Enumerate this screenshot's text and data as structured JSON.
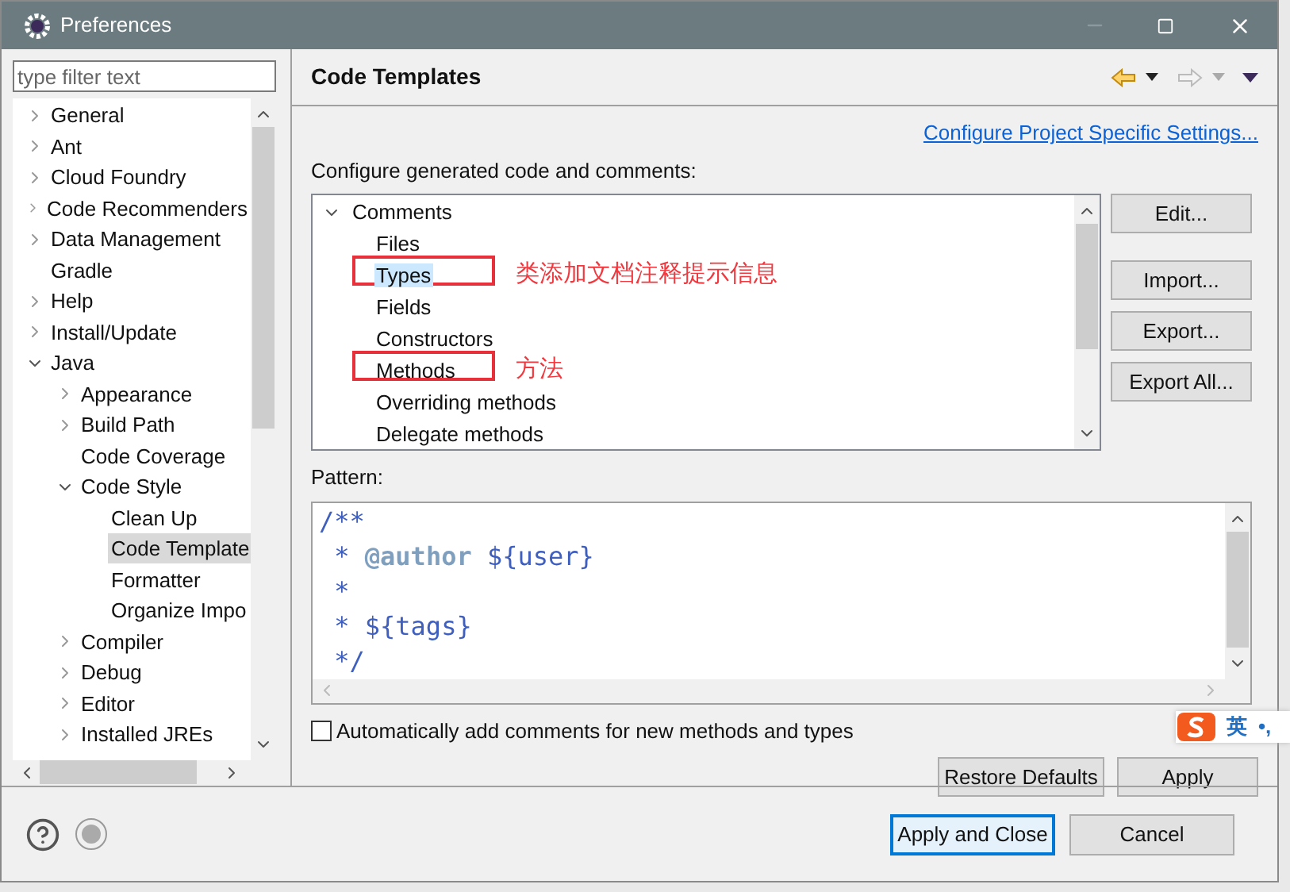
{
  "window": {
    "title": "Preferences"
  },
  "filter": {
    "placeholder": "type filter text"
  },
  "nav": [
    {
      "label": "General",
      "expanded": false,
      "selected": false
    },
    {
      "label": "Ant",
      "expanded": false,
      "selected": false
    },
    {
      "label": "Cloud Foundry",
      "expanded": false,
      "selected": false
    },
    {
      "label": "Code Recommenders",
      "expanded": false,
      "selected": false
    },
    {
      "label": "Data Management",
      "expanded": false,
      "selected": false
    },
    {
      "label": "Gradle",
      "selected": false
    },
    {
      "label": "Help",
      "expanded": false,
      "selected": false
    },
    {
      "label": "Install/Update",
      "expanded": false,
      "selected": false
    },
    {
      "label": "Java",
      "expanded": true,
      "selected": false,
      "children": [
        {
          "label": "Appearance",
          "expanded": false,
          "selected": false
        },
        {
          "label": "Build Path",
          "expanded": false,
          "selected": false
        },
        {
          "label": "Code Coverage",
          "selected": false
        },
        {
          "label": "Code Style",
          "expanded": true,
          "selected": false,
          "children": [
            {
              "label": "Clean Up",
              "selected": false
            },
            {
              "label": "Code Template",
              "selected": true
            },
            {
              "label": "Formatter",
              "selected": false
            },
            {
              "label": "Organize Impo",
              "selected": false
            }
          ]
        },
        {
          "label": "Compiler",
          "expanded": false,
          "selected": false
        },
        {
          "label": "Debug",
          "expanded": false,
          "selected": false
        },
        {
          "label": "Editor",
          "expanded": false,
          "selected": false
        },
        {
          "label": "Installed JREs",
          "expanded": false,
          "selected": false
        }
      ]
    }
  ],
  "page": {
    "title": "Code Templates",
    "link": "Configure Project Specific Settings...",
    "intro": "Configure generated code and comments:"
  },
  "templates": [
    {
      "label": "Comments",
      "expanded": true,
      "selected": false,
      "children": [
        {
          "label": "Files",
          "selected": false
        },
        {
          "label": "Types",
          "selected": true,
          "annotation": "类添加文档注释提示信息"
        },
        {
          "label": "Fields",
          "selected": false
        },
        {
          "label": "Constructors",
          "selected": false
        },
        {
          "label": "Methods",
          "selected": false,
          "annotation": "方法"
        },
        {
          "label": "Overriding methods",
          "selected": false
        },
        {
          "label": "Delegate methods",
          "selected": false
        }
      ]
    }
  ],
  "side_buttons": [
    "Edit...",
    "Import...",
    "Export...",
    "Export All..."
  ],
  "pattern": {
    "label": "Pattern:",
    "lines": [
      [
        {
          "kind": "text",
          "text": "/**"
        }
      ],
      [
        {
          "kind": "text",
          "text": " * "
        },
        {
          "kind": "tag",
          "text": "@author"
        },
        {
          "kind": "text",
          "text": " ${user}"
        }
      ],
      [
        {
          "kind": "text",
          "text": " *"
        }
      ],
      [
        {
          "kind": "text",
          "text": " * ${tags}"
        }
      ],
      [
        {
          "kind": "text",
          "text": " */"
        }
      ]
    ]
  },
  "auto_comments": {
    "label": "Automatically add comments for new methods and types",
    "checked": false
  },
  "page_buttons": [
    "Restore Defaults",
    "Apply"
  ],
  "ime": {
    "mode": "英",
    "punct": "•,"
  },
  "dialog_buttons": [
    {
      "label": "Apply and Close",
      "selected": true
    },
    {
      "label": "Cancel",
      "selected": false
    }
  ]
}
